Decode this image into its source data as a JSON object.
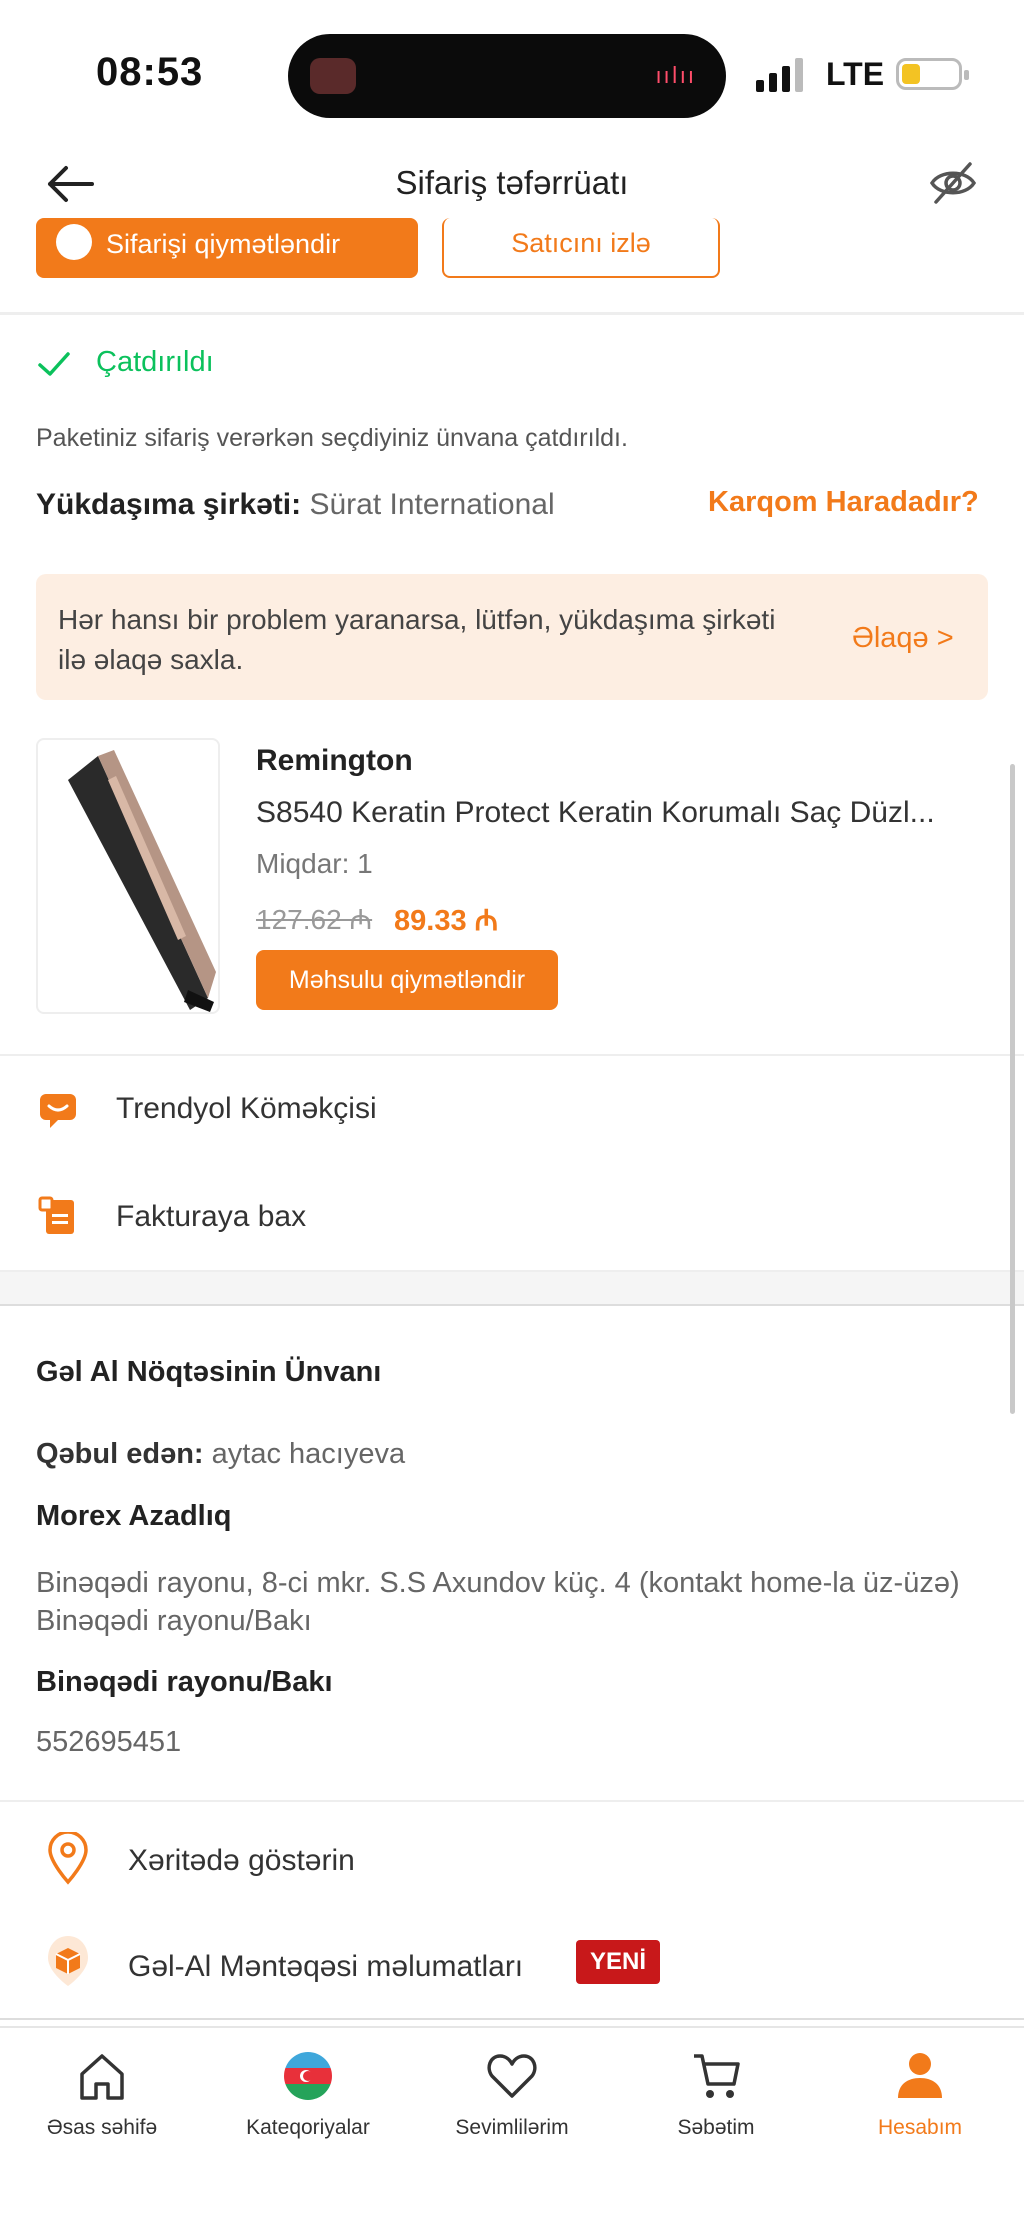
{
  "status_bar": {
    "time": "08:53",
    "network": "LTE",
    "battery_color": "#f3c323"
  },
  "header": {
    "title": "Sifariş təfərrüatı",
    "back_icon": "arrow-left-icon",
    "privacy_icon": "eye-off-icon"
  },
  "top_actions": {
    "rate_order_label": "Sifarişi qiymətləndir",
    "follow_seller_label": "Satıcını izlə"
  },
  "delivery": {
    "status": "Çatdırıldı",
    "status_color": "#0bc15c",
    "message": "Paketiniz sifariş verərkən seçdiyiniz ünvana çatdırıldı.",
    "carrier_label": "Yükdaşıma şirkəti:",
    "carrier_value": "Sürat International",
    "track_link": "Karqom Haradadır?"
  },
  "notice": {
    "text": "Hər hansı bir problem yaranarsa, lütfən, yükdaşıma şirkəti ilə əlaqə saxla.",
    "contact_label": "Əlaqə >"
  },
  "product": {
    "brand": "Remington",
    "name": "S8540 Keratin Protect Keratin Korumalı Saç Düzl...",
    "qty_label": "Miqdar:",
    "qty_value": "1",
    "old_price": "127.62 ₼",
    "new_price": "89.33 ₼",
    "rate_label": "Məhsulu qiymətləndir"
  },
  "menu": [
    {
      "label": "Trendyol Köməkçisi",
      "icon": "chat-assistant-icon"
    },
    {
      "label": "Fakturaya bax",
      "icon": "invoice-icon"
    }
  ],
  "address": {
    "title": "Gəl Al Nöqtəsinin Ünvanı",
    "receiver_label": "Qəbul edən:",
    "receiver_value": "aytac hacıyeva",
    "point_name": "Morex Azadlıq",
    "address_line": "Binəqədi rayonu, 8-ci mkr. S.S Axundov küç. 4 (kontakt home-la üz-üzə) Binəqədi rayonu/Bakı",
    "city": "Binəqədi rayonu/Bakı",
    "phone": "552695451"
  },
  "address_actions": [
    {
      "label": "Xəritədə göstərin",
      "icon": "map-pin-icon"
    },
    {
      "label": "Gəl-Al Məntəqəsi məlumatları",
      "icon": "package-icon",
      "badge": "YENİ"
    }
  ],
  "bottom_nav": [
    {
      "label": "Əsas səhifə",
      "icon": "home-icon"
    },
    {
      "label": "Kateqoriyalar",
      "icon": "azerbaijan-flag-icon"
    },
    {
      "label": "Sevimlilərim",
      "icon": "heart-icon"
    },
    {
      "label": "Səbətim",
      "icon": "cart-icon"
    },
    {
      "label": "Hesabım",
      "icon": "account-icon",
      "active": true
    }
  ],
  "colors": {
    "accent": "#f27a1a",
    "success": "#0bc15c",
    "badge": "#c8181a",
    "notice_bg": "#fdeee2"
  }
}
